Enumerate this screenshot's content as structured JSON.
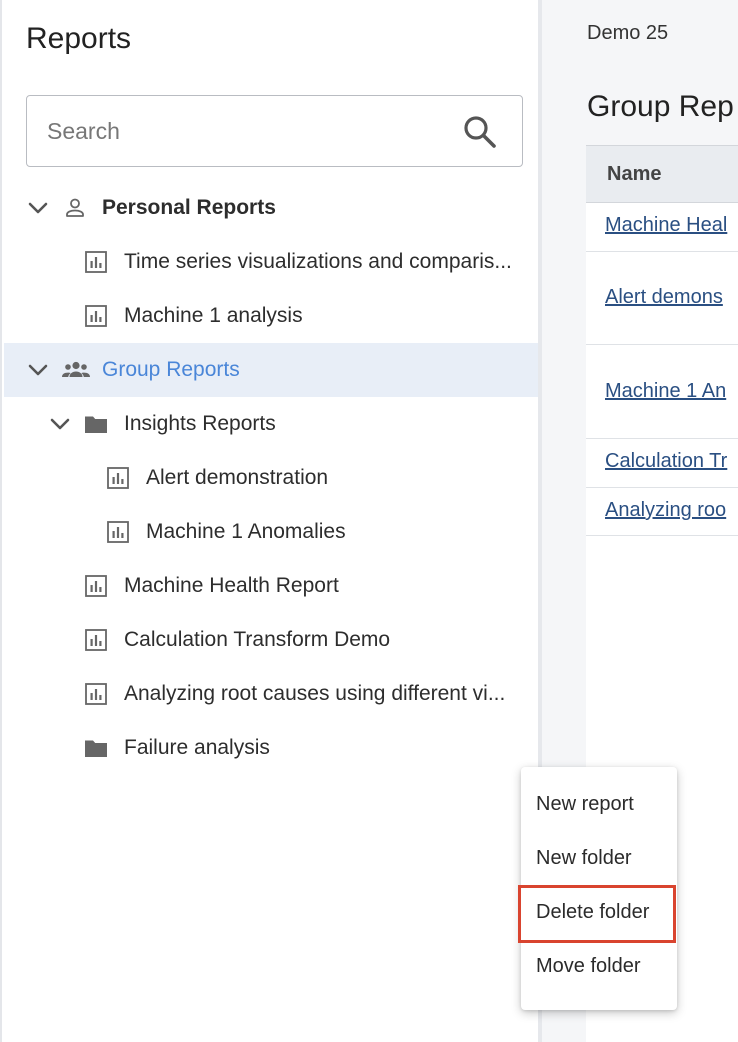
{
  "sidebar": {
    "title": "Reports",
    "search_placeholder": "Search",
    "personal": {
      "label": "Personal Reports",
      "items": [
        "Time series visualizations and comparis...",
        "Machine 1 analysis"
      ]
    },
    "group": {
      "label": "Group Reports",
      "insights_folder": "Insights Reports",
      "insights_items": [
        "Alert demonstration",
        "Machine 1 Anomalies"
      ],
      "items": [
        "Machine Health Report",
        "Calculation Transform Demo",
        "Analyzing root causes using different vi..."
      ],
      "failure_folder": "Failure analysis"
    }
  },
  "main": {
    "breadcrumb": "Demo 25",
    "title": "Group Rep",
    "table_header": "Name",
    "rows": [
      "Machine Heal",
      "Alert demons",
      "Machine 1 An",
      "Calculation Tr",
      "Analyzing roo"
    ]
  },
  "context_menu": {
    "items": [
      "New report",
      "New folder",
      "Delete folder",
      "Move folder"
    ],
    "highlighted_item": "Delete folder",
    "highlight_color": "#d9442f"
  },
  "colors": {
    "selected_row_bg": "#e8eef7",
    "selected_text": "#4a86d8",
    "link": "#2a4f82"
  },
  "icons": {
    "search": "search-icon",
    "chevron": "chevron-down-icon",
    "person": "person-icon",
    "group": "group-icon",
    "report": "report-icon",
    "folder": "folder-icon"
  }
}
